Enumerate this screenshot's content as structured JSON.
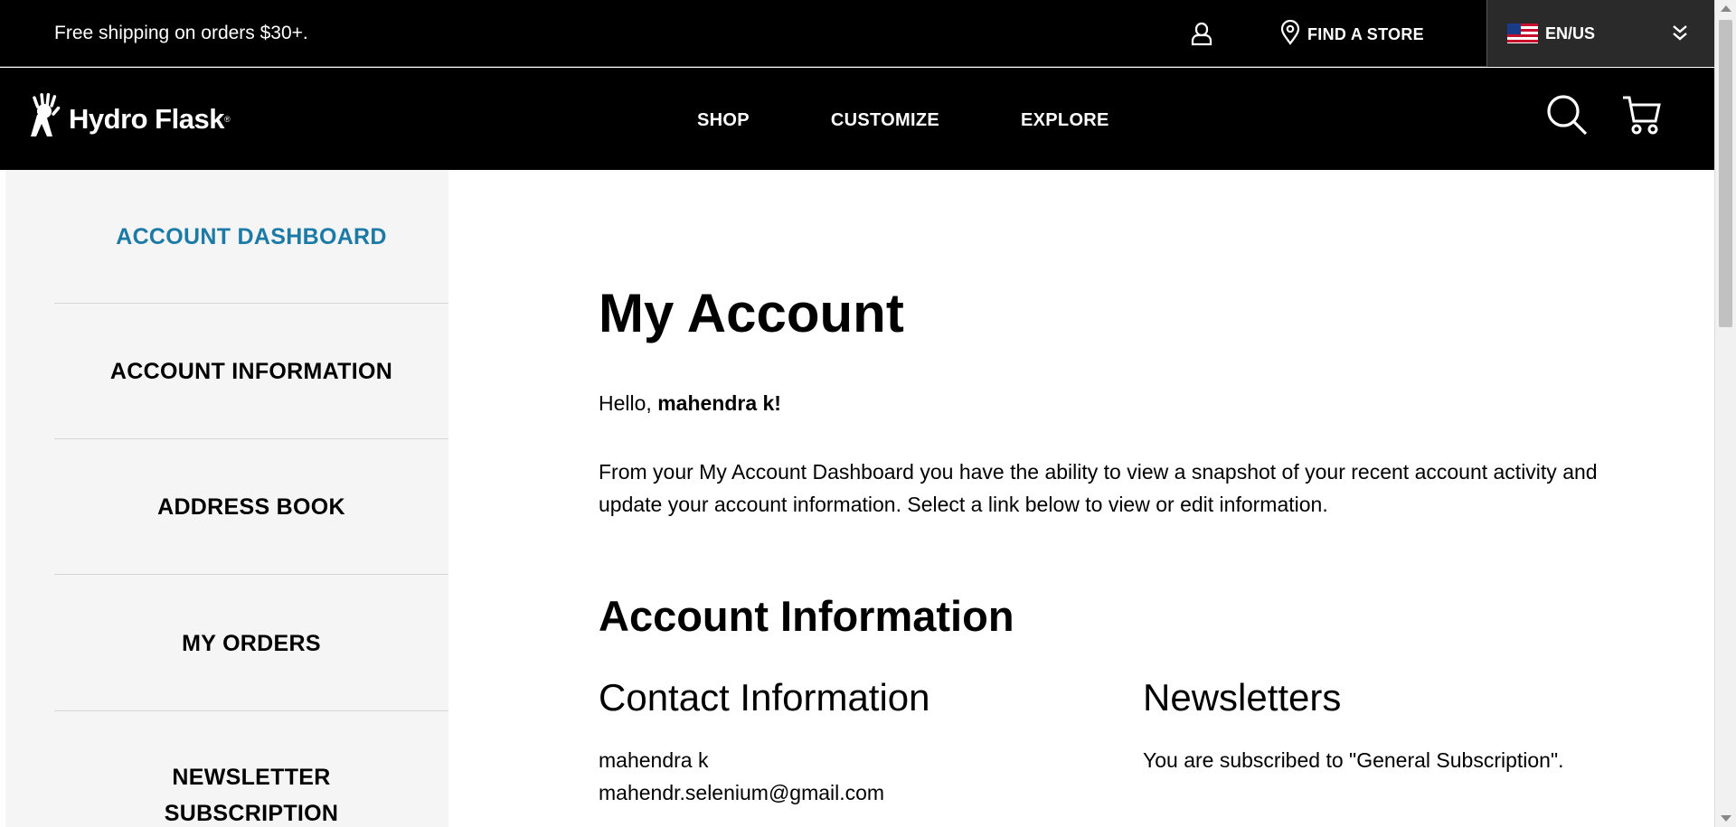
{
  "topbar": {
    "promo": "Free shipping on orders $30+.",
    "find_store": "FIND A STORE",
    "locale": "EN/US"
  },
  "header": {
    "brand": "Hydro Flask",
    "nav": [
      "SHOP",
      "CUSTOMIZE",
      "EXPLORE"
    ]
  },
  "sidebar": {
    "items": [
      {
        "label": "ACCOUNT DASHBOARD",
        "active": true
      },
      {
        "label": "ACCOUNT INFORMATION",
        "active": false
      },
      {
        "label": "ADDRESS BOOK",
        "active": false
      },
      {
        "label": "MY ORDERS",
        "active": false
      },
      {
        "label": "NEWSLETTER SUBSCRIPTION",
        "active": false
      }
    ]
  },
  "main": {
    "title": "My Account",
    "hello_prefix": "Hello, ",
    "hello_name": "mahendra k!",
    "intro": "From your My Account Dashboard you have the ability to view a snapshot of your recent account activity and update your account information. Select a link below to view or edit information.",
    "section_title": "Account Information",
    "contact": {
      "heading": "Contact Information",
      "name": "mahendra k",
      "email": "mahendr.selenium@gmail.com"
    },
    "newsletters": {
      "heading": "Newsletters",
      "status": "You are subscribed to \"General Subscription\"."
    }
  },
  "colors": {
    "header_bg": "#000000",
    "accent_active": "#1b7aa6",
    "sidebar_bg": "#f5f5f5"
  }
}
